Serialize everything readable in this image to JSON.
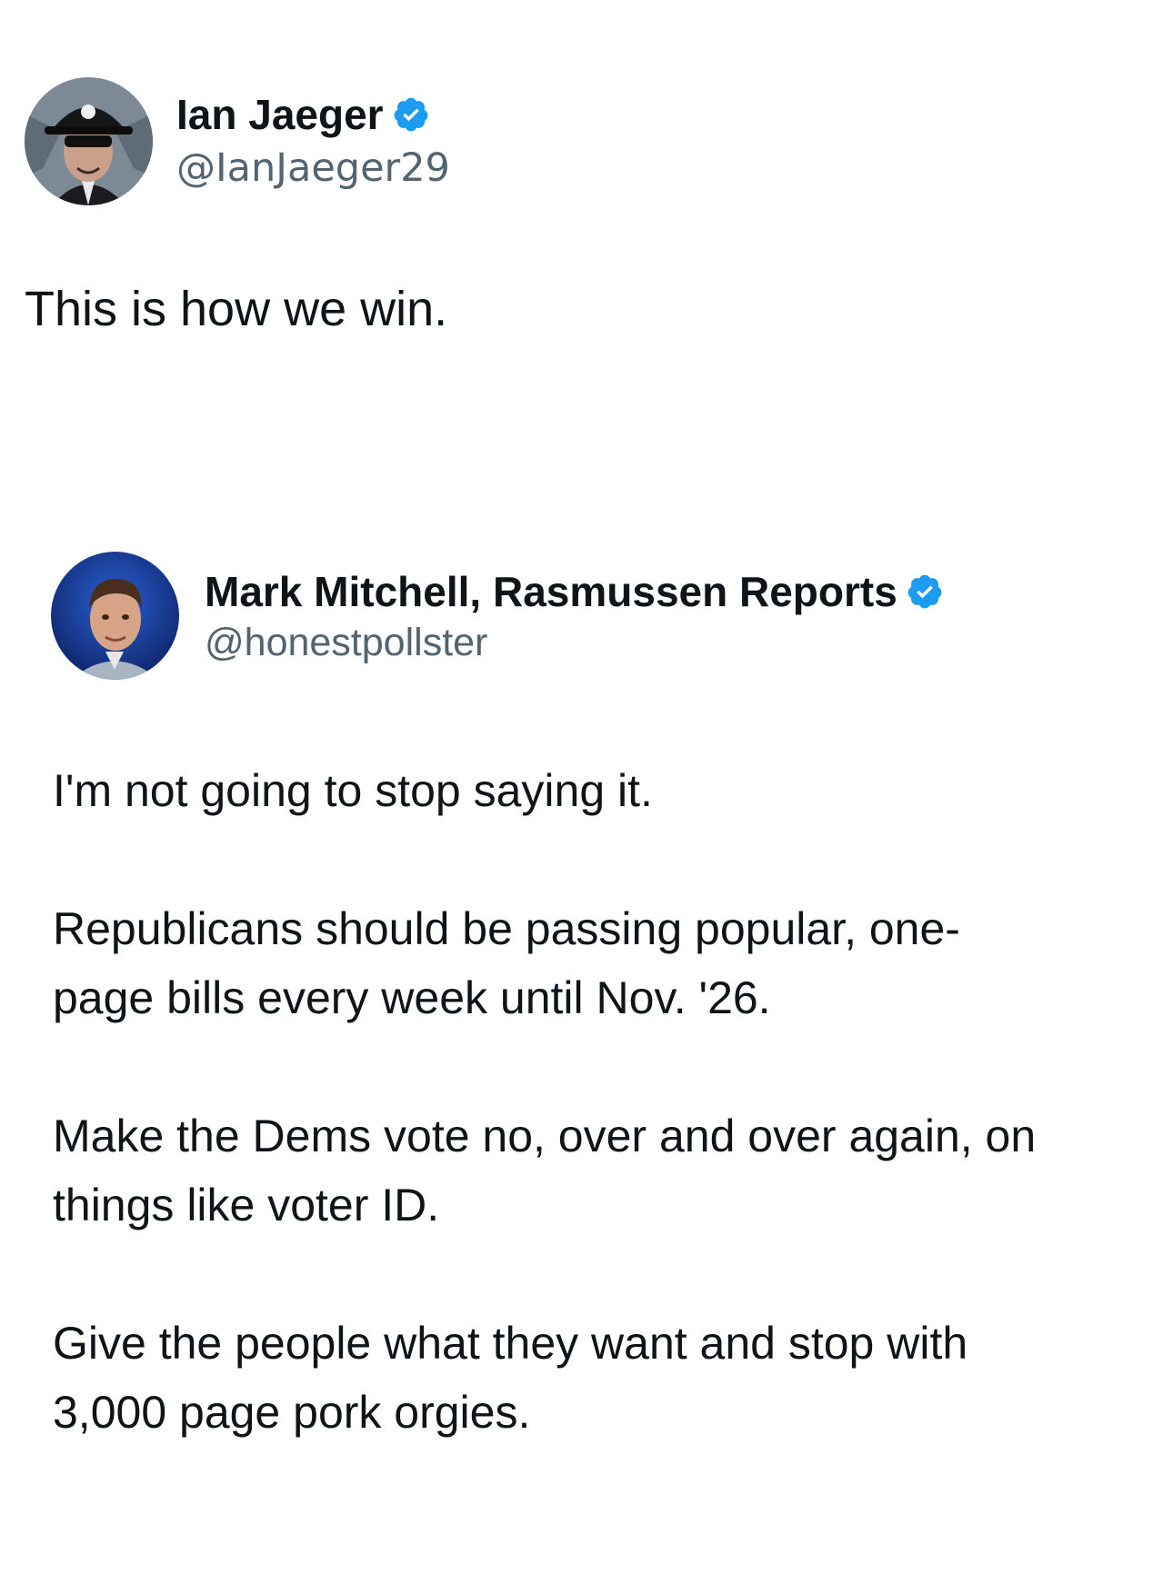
{
  "outer_post": {
    "author_name": "Ian Jaeger",
    "author_handle": "@IanJaeger29",
    "verified": true,
    "avatar_icon": "avatar-man-in-black-cap",
    "text": "This is how we win."
  },
  "quoted_post": {
    "author_name": "Mark Mitchell, Rasmussen Reports",
    "author_handle": "@honestpollster",
    "verified": true,
    "avatar_icon": "avatar-man-portrait",
    "paragraphs": [
      "I'm not going to stop saying it.",
      "Republicans should be passing popular, one-\npage bills every week until Nov. '26.",
      "Make the Dems vote no, over and over again, on\nthings like voter ID.",
      "Give the people what they want and stop with\n3,000 page pork orgies."
    ]
  },
  "colors": {
    "text_primary": "#0f1419",
    "text_secondary": "#536471",
    "verified_badge": "#1d9bf0",
    "background": "#ffffff"
  }
}
